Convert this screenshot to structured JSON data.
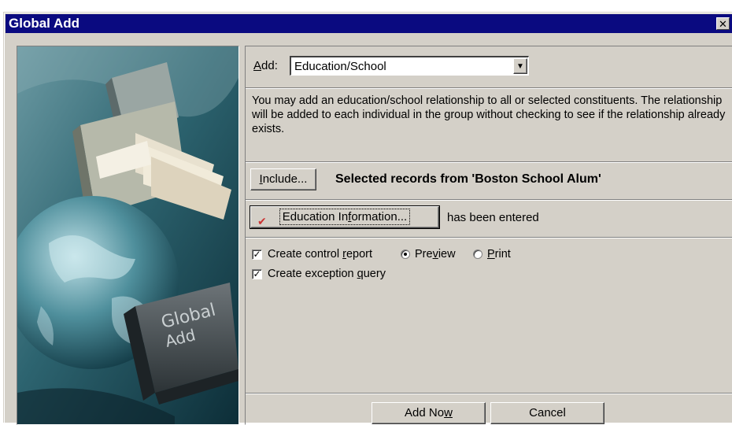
{
  "window": {
    "title": "Global Add",
    "close_glyph": "✕"
  },
  "image": {
    "caption_line1": "Global",
    "caption_line2": "Add"
  },
  "add": {
    "label_accel": "A",
    "label_rest": "dd:",
    "selected": "Education/School"
  },
  "description": "You may add an education/school relationship to all or selected constituents. The relationship will be added to each individual in the group without checking to see if the relationship already exists.",
  "include": {
    "button_accel": "I",
    "button_rest": "nclude...",
    "selected_text": "Selected records from 'Boston School Alum'"
  },
  "education_info": {
    "button_pre": "Education In",
    "button_accel": "f",
    "button_post": "ormation...",
    "status_text": "has been entered"
  },
  "options": {
    "control_report": {
      "checked": true,
      "label_pre": "Create control ",
      "label_accel": "r",
      "label_post": "eport"
    },
    "preview": {
      "selected": true,
      "label_pre": "Pre",
      "label_accel": "v",
      "label_post": "iew"
    },
    "print": {
      "selected": false,
      "label_accel": "P",
      "label_post": "rint"
    },
    "exception_query": {
      "checked": true,
      "label_pre": "Create exception ",
      "label_accel": "q",
      "label_post": "uery"
    }
  },
  "footer": {
    "add_now_pre": "Add No",
    "add_now_accel": "w",
    "cancel": "Cancel"
  },
  "colors": {
    "titlebar": "#0a0a80",
    "dialog_bg": "#d4d0c8",
    "check_accent": "#cc3333"
  },
  "icons": {
    "close": "close-icon",
    "dropdown": "chevron-down-icon",
    "checkmark": "checkmark-icon"
  }
}
